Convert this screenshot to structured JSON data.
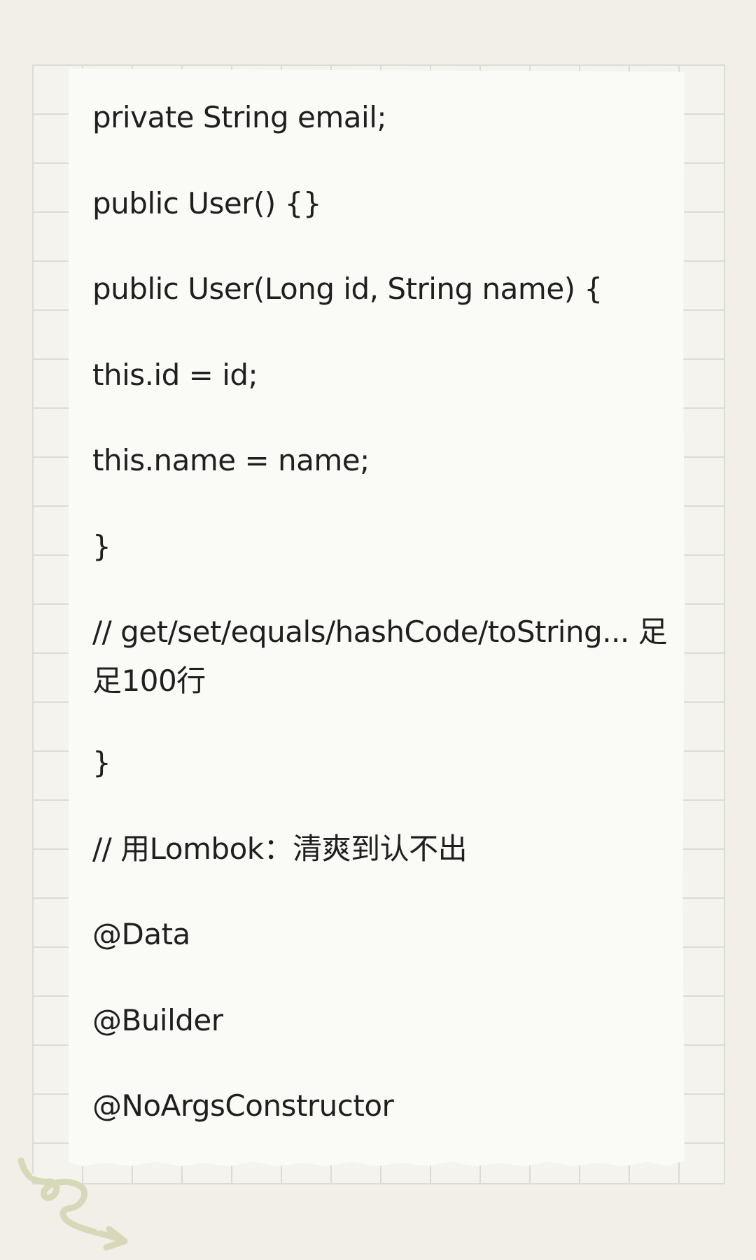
{
  "code": {
    "lines": [
      "private String email;",
      "public User() {}",
      "public User(Long id, String name) {",
      "this.id = id;",
      "this.name = name;",
      "}",
      "//   get/set/equals/hashCode/toString...  足足100行",
      "}",
      "// 用Lombok：清爽到认不出",
      "@Data",
      "@Builder",
      "@NoArgsConstructor"
    ]
  },
  "colors": {
    "page_background": "#f1efe8",
    "paper": "#fafaf7",
    "grid": "#dcdcd6",
    "text": "#1f1f1f",
    "doodle": "#d8d8b8"
  }
}
